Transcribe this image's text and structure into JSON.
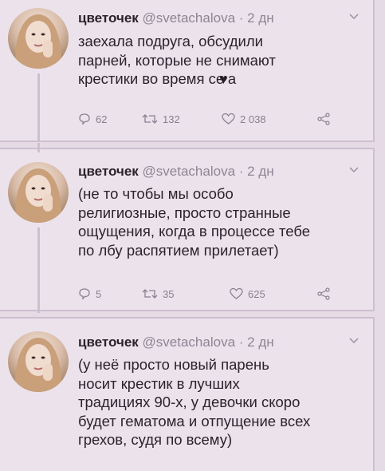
{
  "tweets": [
    {
      "name": "цветочек",
      "handle": "@svetachalova",
      "time": "· 2 дн",
      "lines": [
        "заехала подруга, обсудили",
        "парней, которые не снимают",
        "крестики во время се"
      ],
      "heart": "♥",
      "heart_suffix": "а",
      "replies": "62",
      "retweets": "132",
      "likes": "2 038"
    },
    {
      "name": "цветочек",
      "handle": "@svetachalova",
      "time": "· 2 дн",
      "lines": [
        "(не то чтобы мы особо",
        "религиозные, просто странные",
        "ощущения, когда в процессе тебе",
        "по лбу распятием прилетает)"
      ],
      "replies": "5",
      "retweets": "35",
      "likes": "625"
    },
    {
      "name": "цветочек",
      "handle": "@svetachalova",
      "time": "· 2 дн",
      "lines": [
        "(у неё просто новый парень",
        "носит крестик в лучших",
        "традициях 90-х, у девочки скоро",
        "будет гематома и отпущение всех",
        "грехов, судя по всему)"
      ]
    }
  ],
  "icons": {
    "reply": "reply-icon",
    "retweet": "retweet-icon",
    "like": "heart-icon",
    "share": "share-icon",
    "menu": "chevron-down-icon"
  },
  "colors": {
    "background": "#e6dbe5",
    "card": "#ece2eb",
    "text": "#2b232c",
    "muted": "#8a7f8f"
  }
}
